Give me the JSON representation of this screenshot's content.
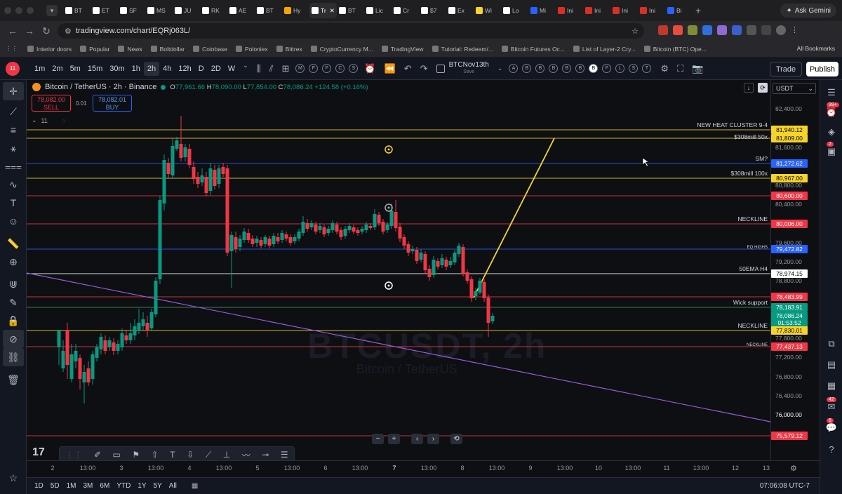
{
  "browser": {
    "tabs": [
      "BT",
      "ET",
      "SF",
      "MS",
      "JU",
      "RK",
      "AE",
      "BT",
      "Hy",
      "Tr",
      "BT",
      "Lic",
      "Cr",
      "$7",
      "Ex",
      "Wi",
      "Lo",
      "Mi",
      "Ini",
      "Ini",
      "Ini",
      "Ini",
      "Bi"
    ],
    "ask_gemini": "Ask Gemini",
    "url": "tradingview.com/chart/EQRj063L/",
    "bookmarks": [
      "Interior doors",
      "Popular",
      "News",
      "Boltdollar",
      "Coinbase",
      "Poloniex",
      "Bittrex",
      "CryptoCurrency M...",
      "TradingView",
      "Tutorial: Redeem/...",
      "Bitcoin Futures Oc...",
      "List of Layer-2 Cry...",
      "Bitcoin (BTC) Ope..."
    ],
    "all_bookmarks": "All Bookmarks"
  },
  "toolbar": {
    "avatar_badge": "11",
    "timeframes": [
      "1m",
      "2m",
      "5m",
      "15m",
      "30m",
      "1h",
      "2h",
      "4h",
      "12h",
      "D",
      "2D",
      "W"
    ],
    "selected_timeframe": "2h",
    "layout_circles_1": [
      "M",
      "F",
      "F",
      "C",
      "S"
    ],
    "layout_name": "BTCNov13th",
    "layout_sub": "Save",
    "layout_circles_2": [
      "A",
      "B",
      "B",
      "B",
      "B",
      "B",
      "B",
      "F",
      "L",
      "S",
      "T"
    ],
    "trade": "Trade",
    "publish": "Publish"
  },
  "symbol": {
    "name": "Bitcoin / TetherUS · 2h · Binance",
    "o": "77,961.66",
    "h": "78,090.00",
    "l": "77,854.00",
    "c": "78,086.24",
    "change": "+124.58 (+0.16%)",
    "sell_price": "78,082.00",
    "sell_label": "SELL",
    "buy_price": "78,082.01",
    "buy_label": "BUY",
    "spread": "0.01",
    "indicators_count": "11",
    "currency": "USDT",
    "watermark": "BTCUSDT, 2h",
    "watermark_sub": "Bitcoin / TetherUS"
  },
  "price_ticks": [
    "82,400.00",
    "82,000.00",
    "81,600.00",
    "80,800.00",
    "80,400.00",
    "79,600.00",
    "79,200.00",
    "78,800.00",
    "77,600.00",
    "77,200.00",
    "76,800.00",
    "76,400.00",
    "76,000.00"
  ],
  "level_labels": [
    {
      "name": "NEW HEAT CLUSTER 9-4",
      "price": "81,940.12",
      "color": "#f7d42b"
    },
    {
      "name": "$308mill 50x",
      "price": "81,809.00",
      "color": "#f7d42b"
    },
    {
      "name": "SM?",
      "price": "81,272.62",
      "color": "#2962ff"
    },
    {
      "name": "$308mill 100x",
      "price": "80,967.00",
      "color": "#f7d42b"
    },
    {
      "name": "",
      "price": "80,600.00",
      "color": "#f23645"
    },
    {
      "name": "NECKLINE",
      "price": "80,006.00",
      "color": "#f23645"
    },
    {
      "name": "EQ HIGHS",
      "price": "79,472.82",
      "color": "#2962ff"
    },
    {
      "name": "50EMA H4",
      "price": "78,974.15",
      "color": "#ffffff"
    },
    {
      "name": "",
      "price": "78,483.99",
      "color": "#f23645"
    },
    {
      "name": "Wick support",
      "price": "78,183.91",
      "color": "#089981"
    },
    {
      "name": "",
      "price": "78,086.24",
      "color": "#089981"
    },
    {
      "name": "",
      "price": "01:53:52",
      "color": "#089981"
    },
    {
      "name": "NECKLINE",
      "price": "77,830.01",
      "color": "#f7d42b"
    },
    {
      "name": "NECKLINE",
      "price": "77,437.13",
      "color": "#f23645"
    },
    {
      "name": "",
      "price": "75,579.12",
      "color": "#f23645"
    }
  ],
  "time_ticks": [
    "2",
    "13:00",
    "3",
    "13:00",
    "4",
    "13:00",
    "5",
    "13:00",
    "6",
    "13:00",
    "7",
    "13:00",
    "8",
    "13:00",
    "9",
    "13:00",
    "10",
    "13:00",
    "11",
    "13:00",
    "12",
    "13"
  ],
  "bottom": {
    "ranges": [
      "1D",
      "5D",
      "1M",
      "3M",
      "6M",
      "YTD",
      "1Y",
      "5Y",
      "All"
    ],
    "clock": "07:06:08 UTC-7"
  },
  "right_badges": {
    "alerts": "99+",
    "notifications": "2",
    "ideas": "42",
    "chat": "6"
  }
}
